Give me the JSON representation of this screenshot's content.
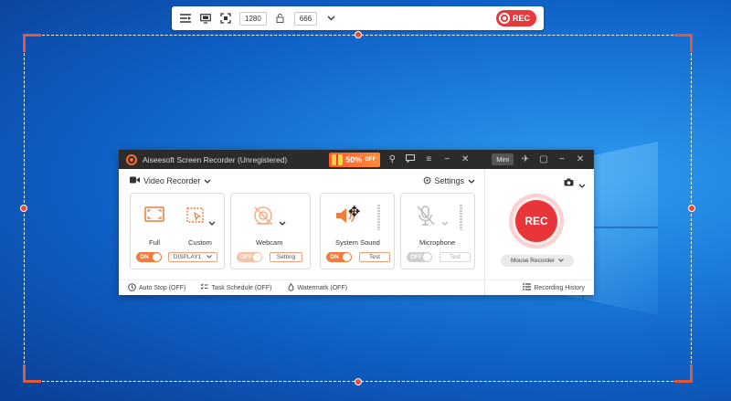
{
  "toolbar": {
    "width_value": "1280",
    "height_value": "666",
    "rec_label": "REC"
  },
  "app": {
    "title": "Aiseesoft Screen Recorder (Unregistered)",
    "promo_percent": "50%",
    "promo_suffix": "OFF",
    "mini_label": "Mini",
    "mode_label": "Video Recorder",
    "settings_label": "Settings",
    "display": {
      "full_label": "Full",
      "custom_label": "Custom",
      "toggle": "ON",
      "display_select": "DISPLAY1"
    },
    "webcam": {
      "label": "Webcam",
      "toggle": "OFF",
      "button": "Setting"
    },
    "system_sound": {
      "label": "System Sound",
      "toggle": "ON",
      "button": "Test"
    },
    "microphone": {
      "label": "Microphone",
      "toggle": "OFF",
      "button": "Test"
    },
    "rec_label": "REC",
    "mouse_recorder_label": "Mouse Recorder",
    "bottom": {
      "auto_stop": "Auto Stop (OFF)",
      "task_schedule": "Task Schedule (OFF)",
      "watermark": "Watermark (OFF)",
      "history": "Recording History"
    }
  },
  "colors": {
    "accent": "#f27a3a",
    "rec": "#e8353a",
    "titlebar": "#2b2b2b"
  }
}
